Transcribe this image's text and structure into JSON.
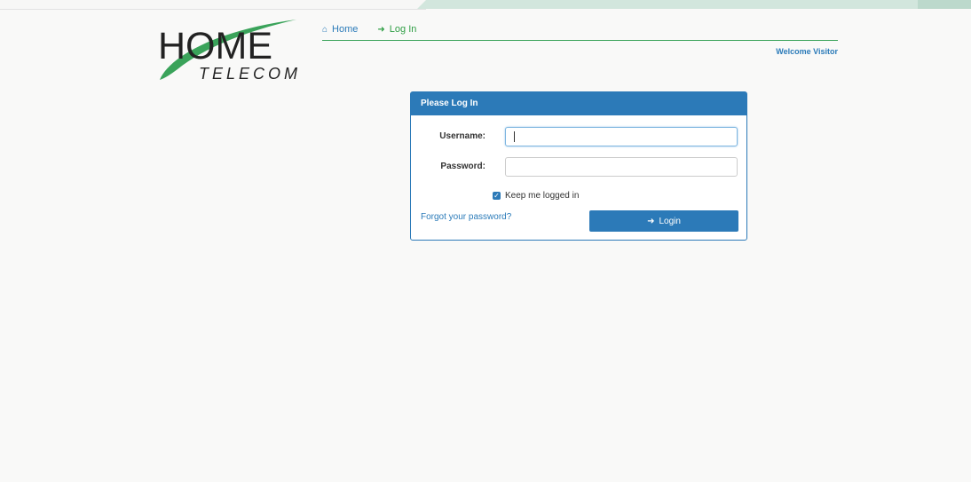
{
  "brand": {
    "logo_word1": "HOME",
    "logo_word2": "TELECOM"
  },
  "nav": {
    "items": [
      {
        "label": "Home",
        "icon": "home-icon"
      },
      {
        "label": "Log In",
        "icon": "sign-in-icon"
      }
    ],
    "welcome": "Welcome Visitor"
  },
  "login_panel": {
    "title": "Please Log In",
    "username_label": "Username:",
    "username_value": "",
    "password_label": "Password:",
    "password_value": "",
    "keep_logged_in_label": "Keep me logged in",
    "keep_logged_in_checked": true,
    "forgot_link": "Forgot your password?",
    "login_button": "Login"
  },
  "colors": {
    "primary": "#2c7ab8",
    "accent_green": "#2f9e44",
    "link_blue": "#2b7bb9"
  }
}
